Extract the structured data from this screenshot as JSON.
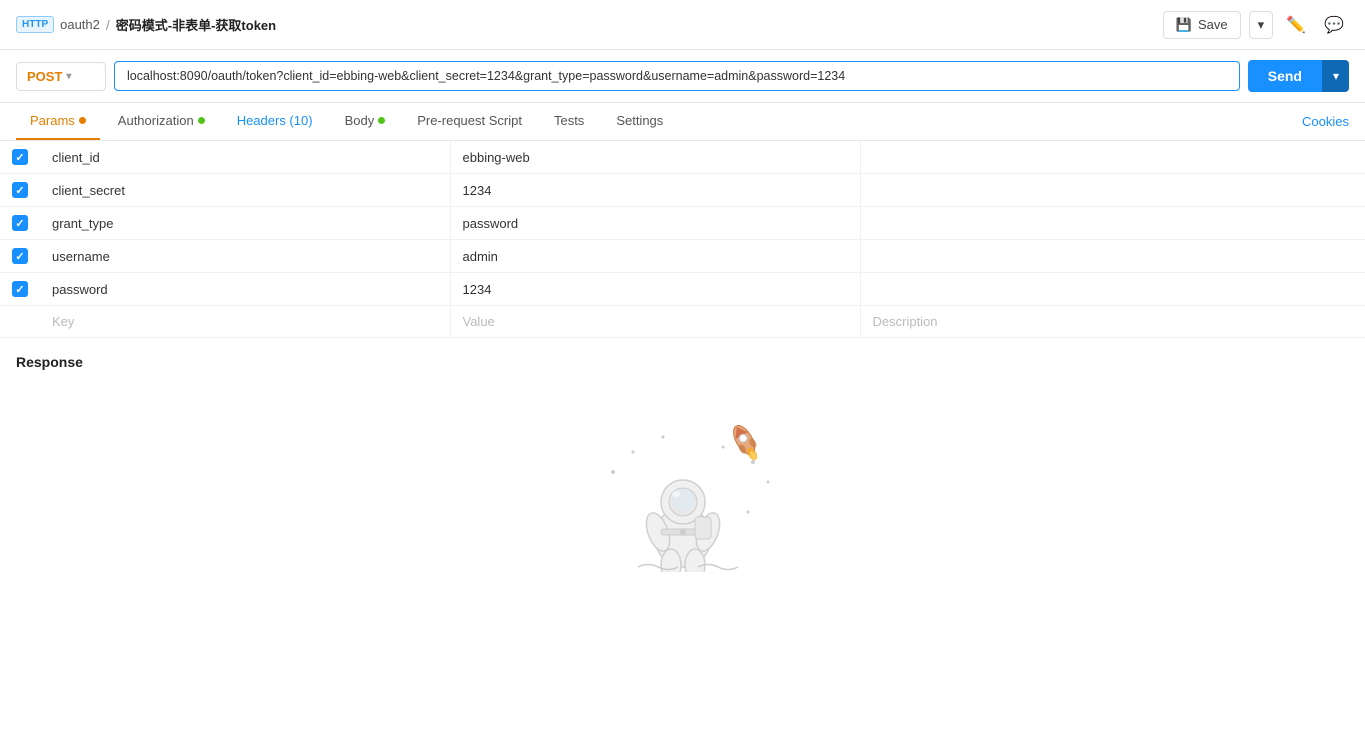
{
  "topbar": {
    "http_badge": "HTTP",
    "breadcrumb_parent": "oauth2",
    "breadcrumb_sep": "/",
    "breadcrumb_title": "密码模式-非表单-获取token",
    "save_label": "Save",
    "save_icon": "💾"
  },
  "urlbar": {
    "method": "POST",
    "url": "localhost:8090/oauth/token?client_id=ebbing-web&client_secret=1234&grant_type=password&username=admin&password=1234",
    "send_label": "Send"
  },
  "tabs": [
    {
      "id": "params",
      "label": "Params",
      "dot": "orange",
      "active": true
    },
    {
      "id": "authorization",
      "label": "Authorization",
      "dot": "green",
      "active": false
    },
    {
      "id": "headers",
      "label": "Headers (10)",
      "dot": null,
      "active": false,
      "color": "blue"
    },
    {
      "id": "body",
      "label": "Body",
      "dot": "green",
      "active": false
    },
    {
      "id": "pre-request",
      "label": "Pre-request Script",
      "dot": null,
      "active": false
    },
    {
      "id": "tests",
      "label": "Tests",
      "dot": null,
      "active": false
    },
    {
      "id": "settings",
      "label": "Settings",
      "dot": null,
      "active": false
    }
  ],
  "cookies_label": "Cookies",
  "table": {
    "headers": [
      "",
      "Key",
      "Value",
      "Description"
    ],
    "rows": [
      {
        "checked": true,
        "key": "client_id",
        "value": "ebbing-web",
        "description": ""
      },
      {
        "checked": true,
        "key": "client_secret",
        "value": "1234",
        "description": ""
      },
      {
        "checked": true,
        "key": "grant_type",
        "value": "password",
        "description": ""
      },
      {
        "checked": true,
        "key": "username",
        "value": "admin",
        "description": ""
      },
      {
        "checked": true,
        "key": "password",
        "value": "1234",
        "description": ""
      }
    ],
    "placeholder_key": "Key",
    "placeholder_value": "Value",
    "placeholder_description": "Description"
  },
  "response": {
    "title": "Response"
  }
}
